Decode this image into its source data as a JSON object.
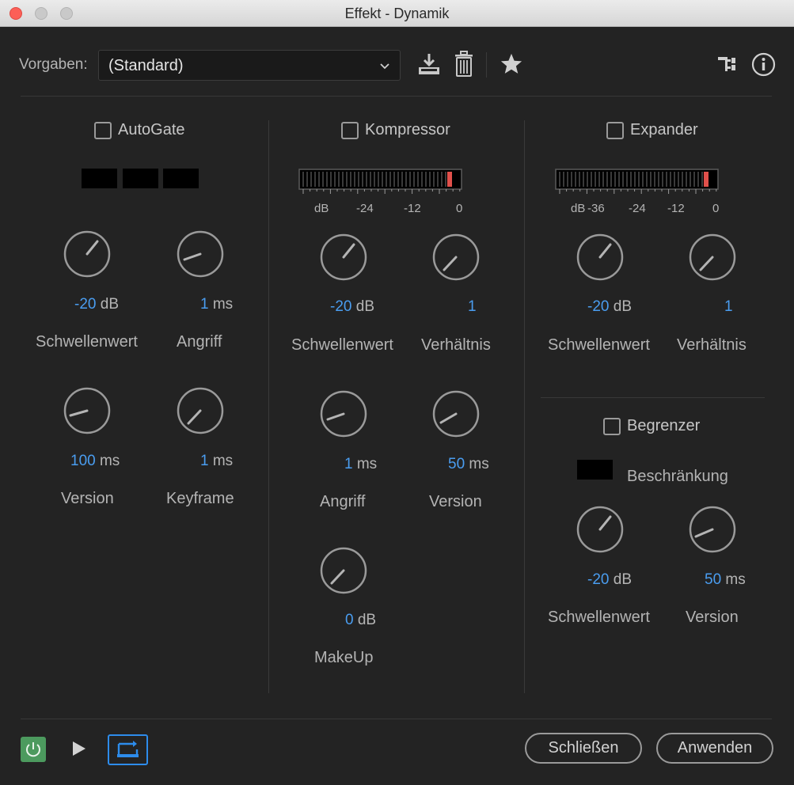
{
  "window": {
    "title": "Effekt - Dynamik"
  },
  "header": {
    "preset_label": "Vorgaben:",
    "preset_value": "(Standard)",
    "icons": [
      "save-preset-icon",
      "trash-icon",
      "star-icon",
      "routing-icon",
      "info-icon"
    ]
  },
  "autogate": {
    "title": "AutoGate",
    "enabled": false,
    "threshold": {
      "num": "-20",
      "unit": "dB",
      "label": "Schwellenwert"
    },
    "attack": {
      "num": "1",
      "unit": "ms",
      "label": "Angriff"
    },
    "release": {
      "num": "100",
      "unit": "ms",
      "label": "Version"
    },
    "hold": {
      "num": "1",
      "unit": "ms",
      "label": "Keyframe"
    }
  },
  "compressor": {
    "title": "Kompressor",
    "enabled": false,
    "meter_ticks": [
      "dB",
      "-24",
      "-12",
      "0"
    ],
    "threshold": {
      "num": "-20",
      "unit": "dB",
      "label": "Schwellenwert"
    },
    "ratio": {
      "num": "1",
      "unit": "",
      "label": "Verhältnis"
    },
    "attack": {
      "num": "1",
      "unit": "ms",
      "label": "Angriff"
    },
    "release": {
      "num": "50",
      "unit": "ms",
      "label": "Version"
    },
    "makeup": {
      "num": "0",
      "unit": "dB",
      "label": "MakeUp"
    }
  },
  "expander": {
    "title": "Expander",
    "enabled": false,
    "meter_ticks": [
      "dB",
      "-36",
      "-24",
      "-12",
      "0"
    ],
    "threshold": {
      "num": "-20",
      "unit": "dB",
      "label": "Schwellenwert"
    },
    "ratio": {
      "num": "1",
      "unit": "",
      "label": "Verhältnis"
    }
  },
  "limiter": {
    "title": "Begrenzer",
    "enabled": false,
    "limit_label": "Beschränkung",
    "threshold": {
      "num": "-20",
      "unit": "dB",
      "label": "Schwellenwert"
    },
    "release": {
      "num": "50",
      "unit": "ms",
      "label": "Version"
    }
  },
  "footer": {
    "close_label": "Schließen",
    "apply_label": "Anwenden"
  },
  "colors": {
    "accent_blue": "#4a9df0",
    "power_green": "#4c9a5e",
    "meter_peak": "#e0504b"
  }
}
